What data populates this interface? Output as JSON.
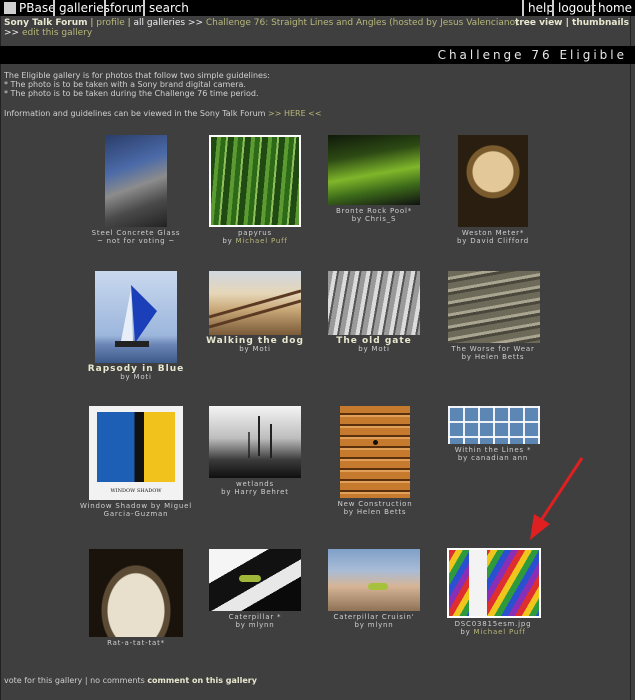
{
  "topbar": {
    "brand": "PBase",
    "nav_left": [
      "galleries",
      "forum",
      "search"
    ],
    "nav_right": [
      "help",
      "logout",
      "home"
    ]
  },
  "breadcrumbs": {
    "forum_label": "Sony Talk Forum",
    "profile": "profile",
    "all_galleries": "all galleries >>",
    "challenge": "Challenge 76: Straight Lines and Angles (hosted by Jesus Valenciano)",
    "arrows": ">>",
    "edit_gallery": "edit this gallery"
  },
  "view_links": {
    "tree_view": "tree view",
    "thumbnails": "thumbnails"
  },
  "gallery_title": "Challenge 76 Eligible",
  "description": {
    "line1": "The Eligible gallery is for photos that follow two simple guidelines:",
    "line2": "* The photo is to be taken with a Sony brand digital camera.",
    "line3": "* The photo is to be taken during the Challenge 76 time period.",
    "info": "Information and guidelines can be viewed in the Sony Talk Forum",
    "here_link": ">> HERE <<"
  },
  "photos": [
    {
      "title": "Steel Concrete Glass",
      "extra": "~ not for voting ~",
      "by": "",
      "author": ""
    },
    {
      "title": "papyrus",
      "extra": "",
      "by": "by",
      "author": "Michael Puff"
    },
    {
      "title": "Bronte Rock Pool*",
      "extra": "",
      "by": "by",
      "author": "Chris_S"
    },
    {
      "title": "Weston Meter*",
      "extra": "",
      "by": "by",
      "author": "David Clifford"
    },
    {
      "title": "Rapsody in Blue",
      "extra": "",
      "by": "by",
      "author": "Moti"
    },
    {
      "title": "Walking the dog",
      "extra": "",
      "by": "by",
      "author": "Moti"
    },
    {
      "title": "The old gate",
      "extra": "",
      "by": "by",
      "author": "Moti"
    },
    {
      "title": "The Worse for Wear",
      "extra": "",
      "by": "by",
      "author": "Helen Betts"
    },
    {
      "title": "Window Shadow by Miguel Garcia-Guzman",
      "extra": "",
      "by": "",
      "author": ""
    },
    {
      "title": "wetlands",
      "extra": "",
      "by": "by",
      "author": "Harry Behret"
    },
    {
      "title": "New Construction",
      "extra": "",
      "by": "by",
      "author": "Helen Betts"
    },
    {
      "title": "Within the Lines *",
      "extra": "",
      "by": "by",
      "author": "canadian ann"
    },
    {
      "title": "Rat-a-tat-tat*",
      "extra": "",
      "by": "",
      "author": ""
    },
    {
      "title": "Caterpillar *",
      "extra": "",
      "by": "by",
      "author": "mlynn"
    },
    {
      "title": "Caterpillar Cruisin'",
      "extra": "",
      "by": "by",
      "author": "mlynn"
    },
    {
      "title": "DSC03815esm.jpg",
      "extra": "",
      "by": "by",
      "author": "Michael Puff"
    }
  ],
  "thumb_labels": {
    "window_shadow": "WINDOW SHADOW"
  },
  "footer": {
    "vote": "vote for this gallery",
    "comments": "no comments",
    "comment_link": "comment on this gallery"
  },
  "colors": {
    "background": "#3f3f3f",
    "link": "#b7b77a",
    "arrow": "#e02020"
  }
}
